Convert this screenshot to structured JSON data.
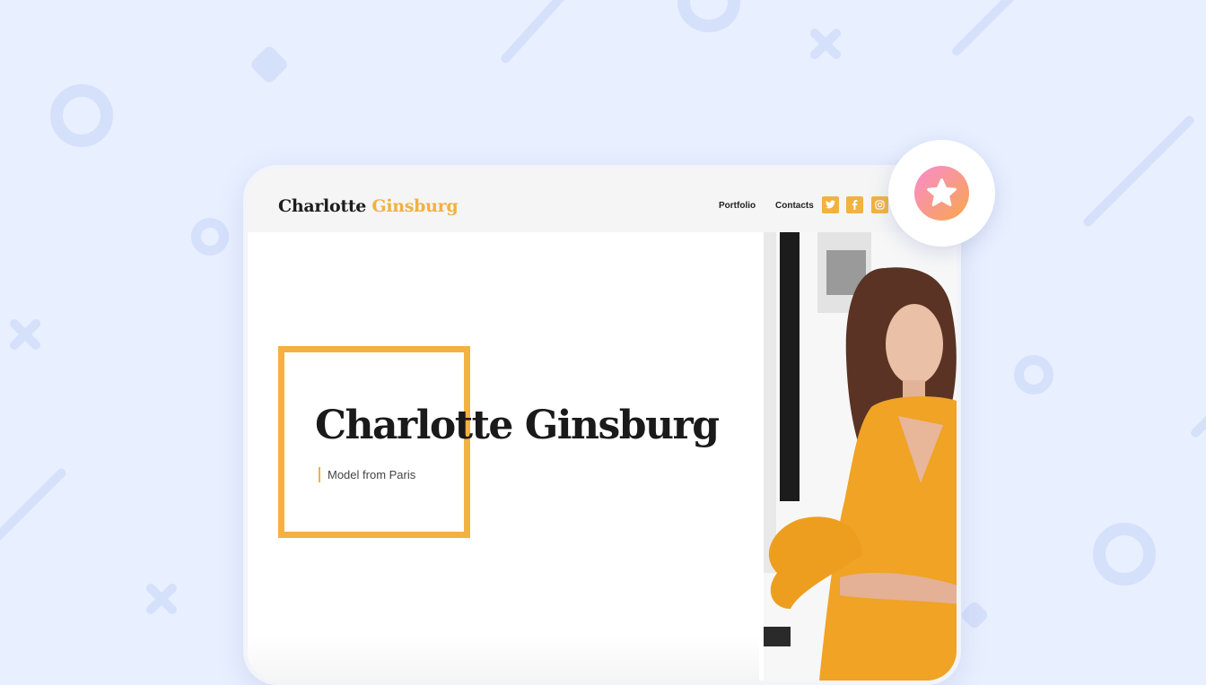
{
  "header": {
    "brand_first": "Charlotte",
    "brand_last": "Ginsburg",
    "nav": [
      "Portfolio",
      "Contacts"
    ],
    "social_icons": [
      "twitter-icon",
      "facebook-icon",
      "instagram-icon"
    ]
  },
  "hero": {
    "title": "Charlotte Ginsburg",
    "subtitle": "Model from Paris"
  },
  "favorite": {
    "icon": "star-icon"
  },
  "colors": {
    "accent": "#f2b140",
    "background": "#e8efff",
    "header_bg": "#f5f5f5",
    "dress": "#f0a324",
    "badge_gradient": [
      "#f98bd0",
      "#f7a74a"
    ]
  }
}
